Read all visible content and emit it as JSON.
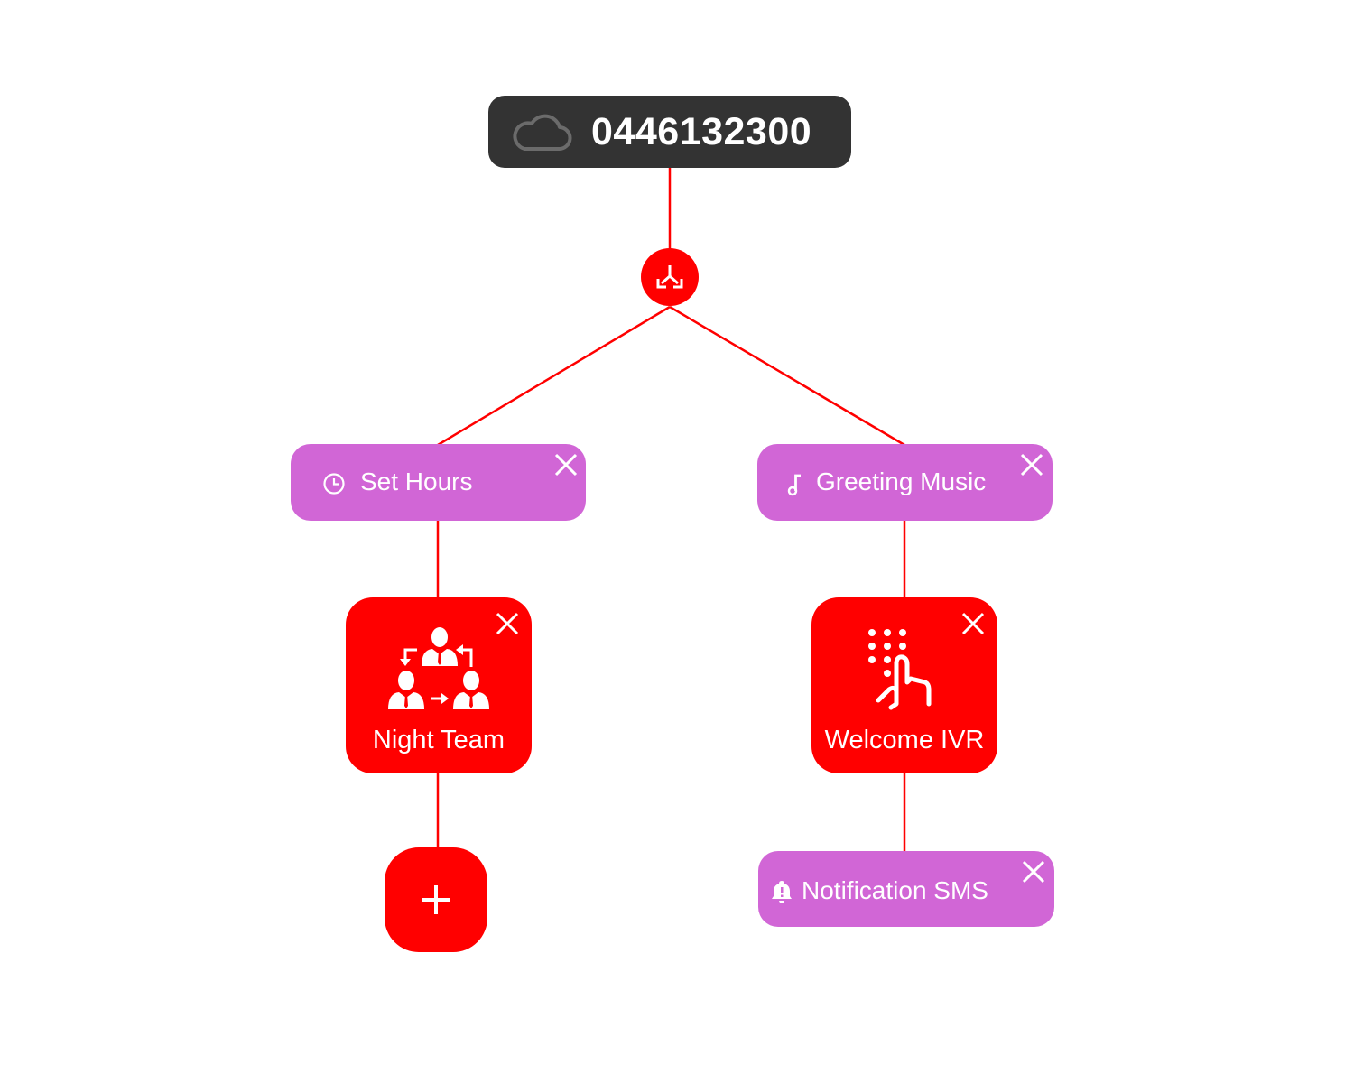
{
  "colors": {
    "connector": "#ff0000",
    "phone_bg": "#333333",
    "pill_bg": "#d166d6",
    "card_bg": "#ff0000",
    "text": "#ffffff",
    "cloud_icon": "#6b6b6b"
  },
  "flow": {
    "phone_node": {
      "icon": "cloud-icon",
      "number": "0446132300"
    },
    "split_node": {
      "icon": "split-arrows-icon"
    },
    "branches": [
      {
        "step": {
          "label": "Set Hours",
          "icon": "clock-icon",
          "close": "close-icon"
        },
        "action": {
          "label": "Night Team",
          "icon": "team-rotation-icon",
          "close": "close-icon"
        },
        "next": {
          "type": "add",
          "icon": "plus-icon"
        }
      },
      {
        "step": {
          "label": "Greeting Music",
          "icon": "music-note-icon",
          "close": "close-icon"
        },
        "action": {
          "label": "Welcome IVR",
          "icon": "keypad-touch-icon",
          "close": "close-icon"
        },
        "next": {
          "type": "step",
          "label": "Notification SMS",
          "icon": "bell-alert-icon",
          "close": "close-icon"
        }
      }
    ]
  }
}
